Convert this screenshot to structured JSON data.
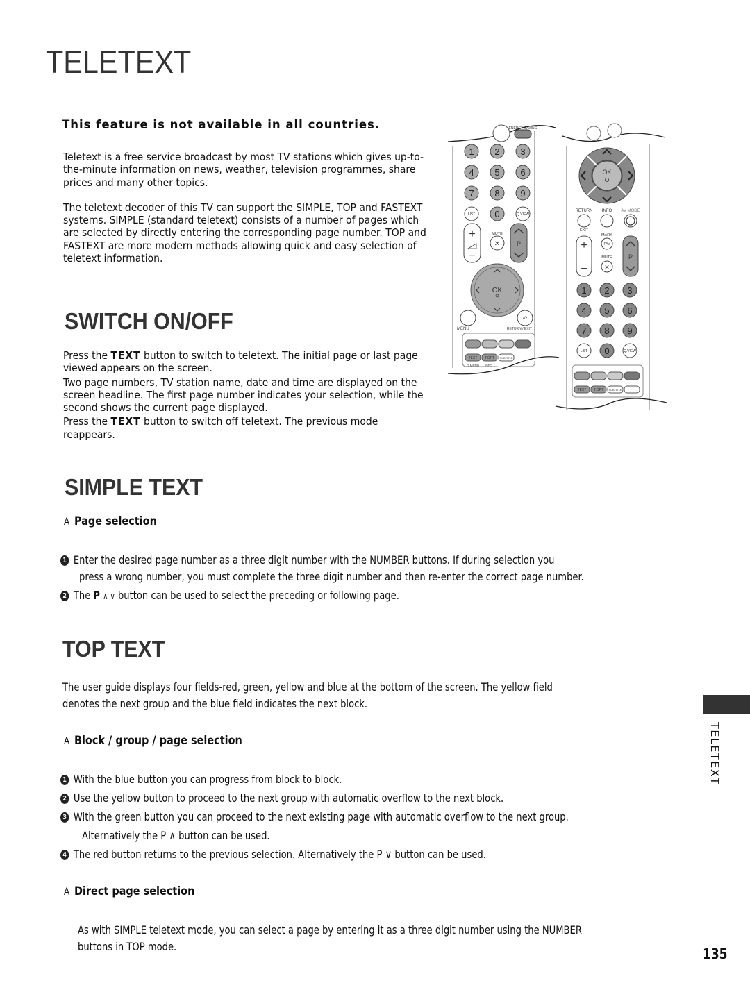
{
  "page": {
    "title": "TELETEXT",
    "note": "This feature is not available in all countries.",
    "intro": [
      "Teletext is a free service broadcast by most TV stations which gives up-to-the-minute information on news, weather, television programmes, share prices and many other topics.",
      "The teletext decoder of this TV can support the SIMPLE, TOP and FASTEXT systems. SIMPLE (standard teletext) consists of a number of pages which are selected by directly entering the corresponding page number. TOP and FASTEXT are more modern methods allowing quick and easy selection of teletext information."
    ],
    "side_tab": "TELETEXT",
    "page_number": "135"
  },
  "switch": {
    "title": "SWITCH ON/OFF",
    "p1_pre": "Press the ",
    "p1_kw": "TEXT",
    "p1_post": " button to switch to teletext. The initial page or last page viewed appears on the screen.",
    "p2": "Two page numbers, TV station name, date and time are displayed on the screen headline. The first page number indicates your selection, while the second shows the current page displayed.",
    "p3_pre": "Press the ",
    "p3_kw": "TEXT",
    "p3_post": " button to switch off teletext. The previous mode reappears."
  },
  "simple": {
    "title": "SIMPLE TEXT",
    "marker": "A",
    "sub": "Page selection",
    "items": [
      {
        "n": "1",
        "line1": "Enter the desired page number as a three digit number with the NUMBER buttons. If during selection you",
        "line2": "press a wrong number, you must complete the three digit number and then re-enter the correct page number."
      },
      {
        "n": "2",
        "pre": "The ",
        "p": "P",
        "arrows": "∧ ∨",
        "post": " button can be used to select the preceding or following page."
      }
    ]
  },
  "top": {
    "title": "TOP TEXT",
    "intro_line1": "The user guide displays four fields-red, green, yellow and blue at the bottom of the screen. The yellow field",
    "intro_line2": "denotes the next group and the blue field indicates the next block.",
    "marker": "A",
    "sub1": "Block / group / page selection",
    "items": [
      {
        "n": "1",
        "text": "With the blue button you can progress from block to block."
      },
      {
        "n": "2",
        "text": "Use the yellow button to proceed to the next group with automatic overflow to the next block."
      },
      {
        "n": "3",
        "text": "With the green button you can proceed to the next existing page with automatic overflow to the next group.",
        "line2": "Alternatively the P ∧  button can be used."
      },
      {
        "n": "4",
        "text": "The red button returns to the previous selection. Alternatively the P ∨  button can be used."
      }
    ],
    "sub2": "Direct page selection",
    "direct_line1": "As with SIMPLE teletext mode, you can select a page by entering it as a three digit number using the NUMBER",
    "direct_line2": "buttons in TOP mode."
  },
  "remote_left": {
    "energy_label": "ENERGY SAVING",
    "digits": [
      "1",
      "2",
      "3",
      "4",
      "5",
      "6",
      "7",
      "8",
      "9"
    ],
    "list": "LIST",
    "zero": "0",
    "qview": "Q.VIEW",
    "mute": "MUTE",
    "p": "P",
    "page": "PAGE",
    "ok": "OK",
    "menu": "MENU",
    "return": "RETURN / EXIT",
    "text": "TEXT",
    "topt": "T.OPT",
    "subtitle": "SUBTITLE",
    "simplink": "SIMPLINK",
    "qmenu": "Q.MENU",
    "info": "INFO"
  },
  "remote_right": {
    "ok": "OK",
    "return": "RETURN",
    "exit": "EXIT",
    "info": "INFO",
    "avmode": "AV MODE",
    "mark": "MARK",
    "fav": "FAV",
    "mute": "MUTE",
    "p": "P",
    "page": "PAGE",
    "digits": [
      "1",
      "2",
      "3",
      "4",
      "5",
      "6",
      "7",
      "8",
      "9"
    ],
    "list": "LIST",
    "zero": "0",
    "qview": "Q.VIEW",
    "text": "TEXT",
    "topt": "T.OPT",
    "subtitle": "SUBTITLE",
    "simplink": "SIMPLINK"
  }
}
